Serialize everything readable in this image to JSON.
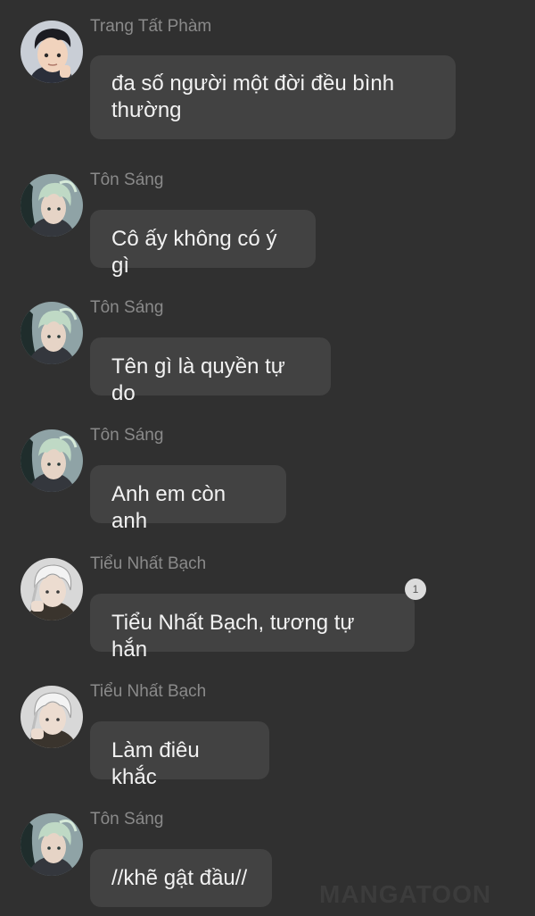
{
  "messages": [
    {
      "sender": "Trang Tất Phàm",
      "avatar": "boy-face-avatar",
      "text": "đa số người một đời đều bình thường"
    },
    {
      "sender": "Tôn Sáng",
      "avatar": "green-hair-avatar",
      "text": "Cô ấy không có ý gì"
    },
    {
      "sender": "Tôn Sáng",
      "avatar": "green-hair-avatar",
      "text": "Tên gì là quyền tự do"
    },
    {
      "sender": "Tôn Sáng",
      "avatar": "green-hair-avatar",
      "text": "Anh em còn anh"
    },
    {
      "sender": "Tiểu Nhất Bạch",
      "avatar": "white-hair-avatar",
      "text": "Tiểu Nhất Bạch, tương tự hắn",
      "badge": "1"
    },
    {
      "sender": "Tiểu Nhất Bạch",
      "avatar": "white-hair-avatar",
      "text": "Làm điêu khắc"
    },
    {
      "sender": "Tôn Sáng",
      "avatar": "green-hair-avatar",
      "text": "//khẽ gật đầu//"
    }
  ],
  "watermark": "MANGATOON",
  "colors": {
    "background": "#303030",
    "bubble": "#424242",
    "sender_name": "#8a8a8a",
    "message_text": "#f2f2f2"
  }
}
